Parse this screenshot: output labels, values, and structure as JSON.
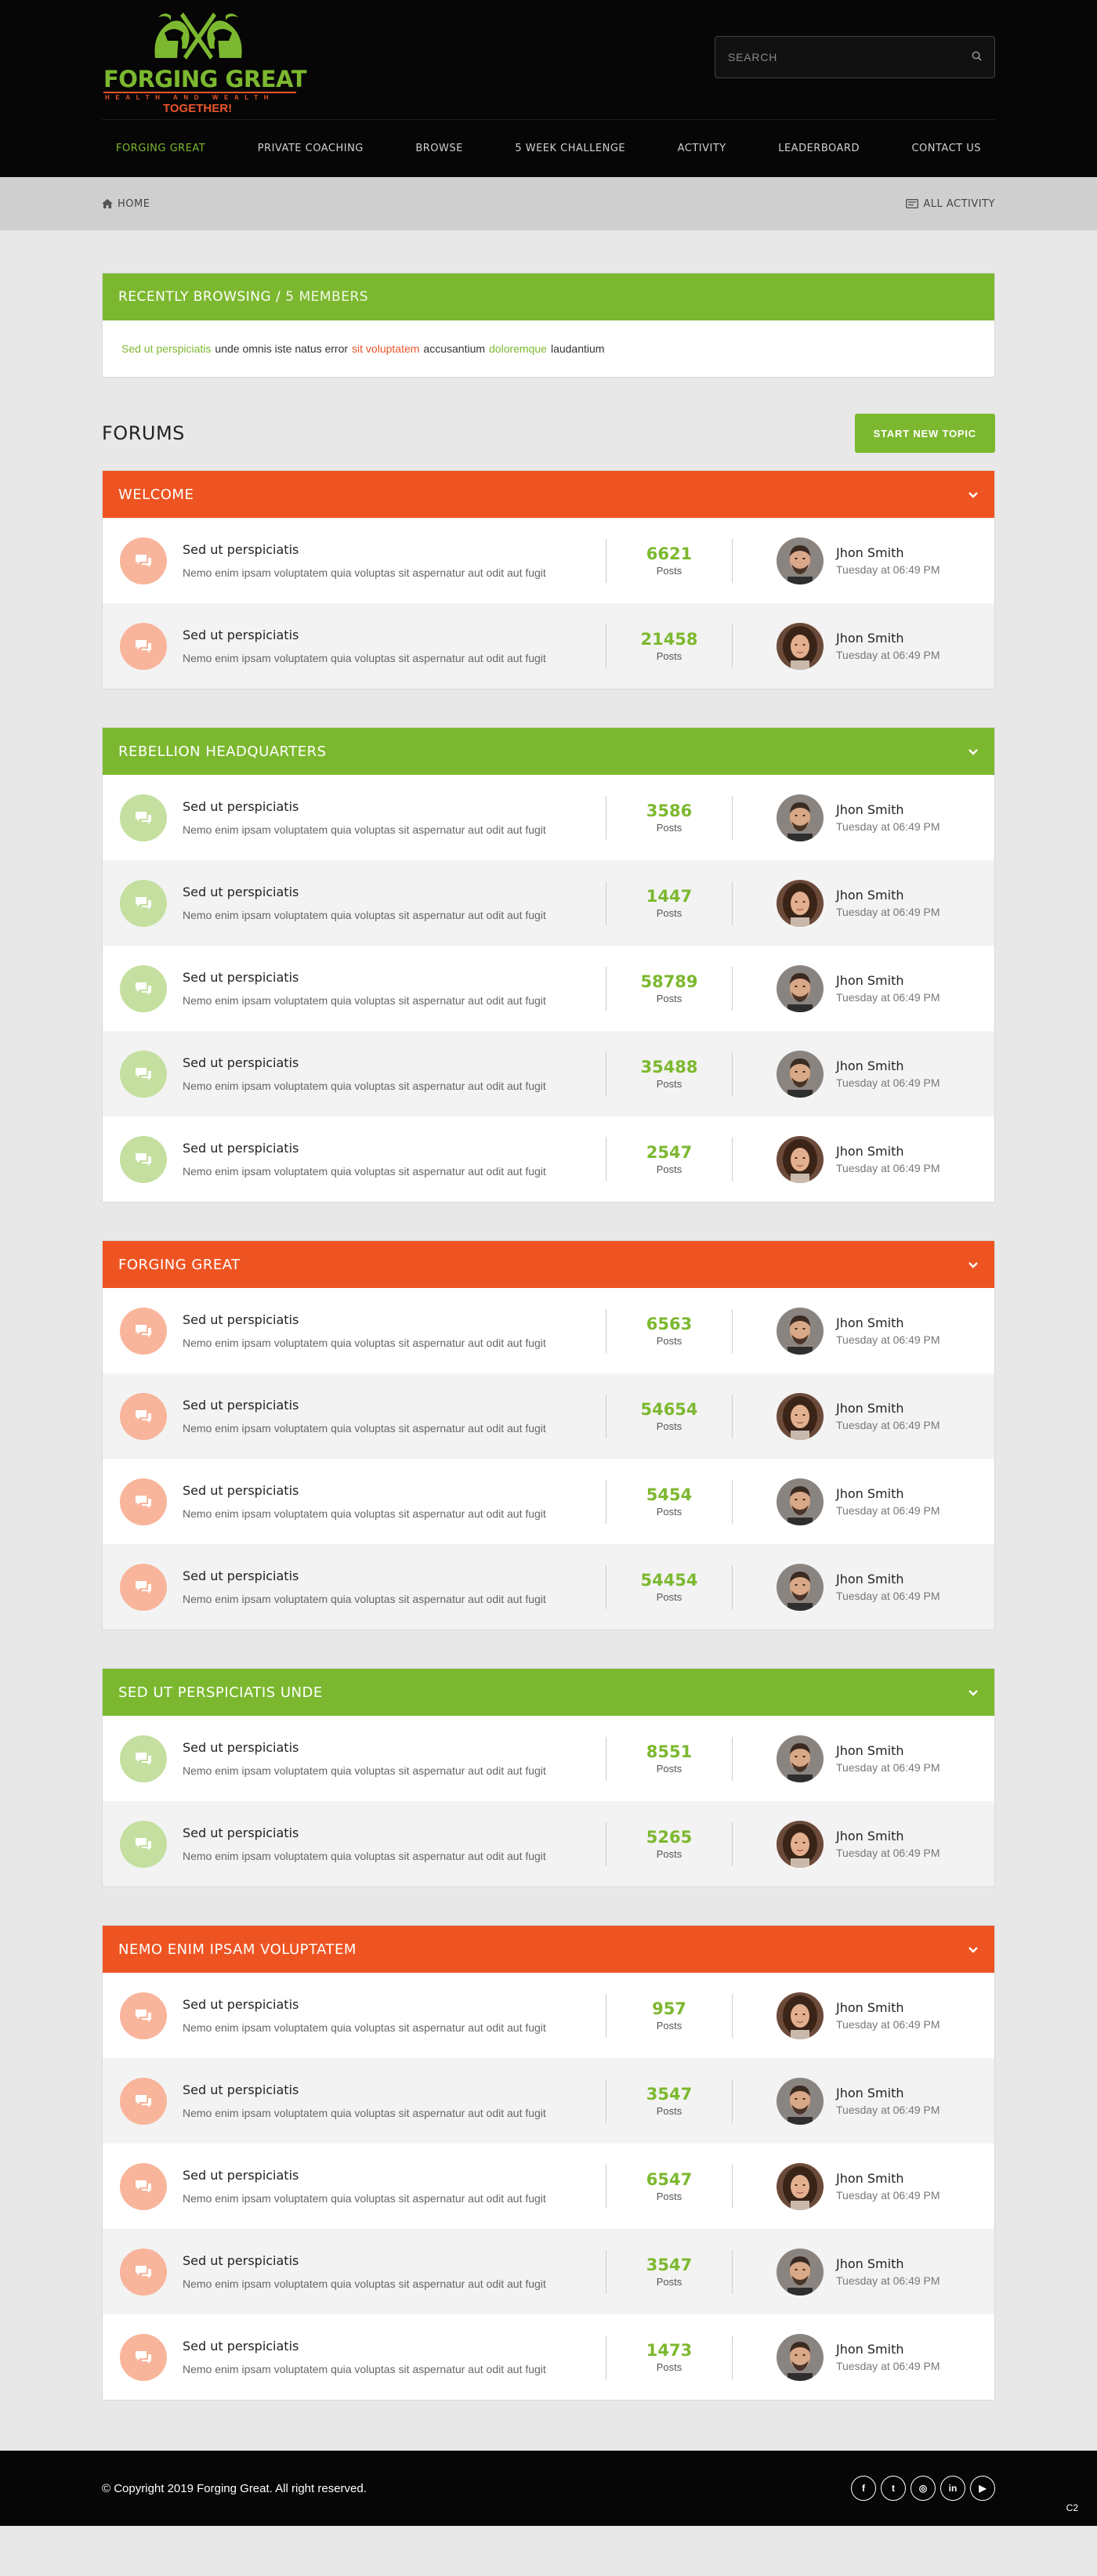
{
  "brand": {
    "name": "FORGING GREAT",
    "subtitle": "HEALTH AND WEALTH",
    "tagline": "TOGETHER!"
  },
  "search": {
    "placeholder": "SEARCH"
  },
  "nav": [
    {
      "label": "FORGING GREAT",
      "active": true
    },
    {
      "label": "PRIVATE COACHING"
    },
    {
      "label": "BROWSE"
    },
    {
      "label": "5 WEEK CHALLENGE"
    },
    {
      "label": "ACTIVITY"
    },
    {
      "label": "LEADERBOARD"
    },
    {
      "label": "CONTACT US"
    }
  ],
  "breadcrumb": {
    "home": "HOME",
    "all_activity": "ALL ACTIVITY"
  },
  "recent": {
    "title": "RECENTLY BROWSING /",
    "count": "5 MEMBERS",
    "parts": [
      {
        "text": "Sed ut perspiciatis",
        "color": "g"
      },
      {
        "text": "unde omnis iste natus error",
        "color": ""
      },
      {
        "text": "sit voluptatem",
        "color": "o"
      },
      {
        "text": "accusantium",
        "color": ""
      },
      {
        "text": "doloremque",
        "color": "g"
      },
      {
        "text": "laudantium",
        "color": ""
      }
    ]
  },
  "forums": {
    "title": "FORUMS",
    "new_topic": "START NEW TOPIC"
  },
  "topic": {
    "title": "Sed ut perspiciatis",
    "desc": "Nemo enim ipsam voluptatem quia voluptas sit aspernatur aut odit aut fugit",
    "posts_label": "Posts",
    "user": "Jhon Smith",
    "date": "Tuesday at 06:49 PM"
  },
  "categories": [
    {
      "title": "WELCOME",
      "color": "orange",
      "rows": [
        {
          "posts": "6621",
          "avatar": "m"
        },
        {
          "posts": "21458",
          "avatar": "f"
        }
      ]
    },
    {
      "title": "REBELLION HEADQUARTERS",
      "color": "green",
      "rows": [
        {
          "posts": "3586",
          "avatar": "m"
        },
        {
          "posts": "1447",
          "avatar": "f"
        },
        {
          "posts": "58789",
          "avatar": "m"
        },
        {
          "posts": "35488",
          "avatar": "m"
        },
        {
          "posts": "2547",
          "avatar": "f"
        }
      ]
    },
    {
      "title": "FORGING GREAT",
      "color": "orange",
      "rows": [
        {
          "posts": "6563",
          "avatar": "m"
        },
        {
          "posts": "54654",
          "avatar": "f"
        },
        {
          "posts": "5454",
          "avatar": "m"
        },
        {
          "posts": "54454",
          "avatar": "m"
        }
      ]
    },
    {
      "title": "SED UT PERSPICIATIS UNDE",
      "color": "green",
      "rows": [
        {
          "posts": "8551",
          "avatar": "m"
        },
        {
          "posts": "5265",
          "avatar": "f"
        }
      ]
    },
    {
      "title": "NEMO ENIM IPSAM VOLUPTATEM",
      "color": "orange",
      "rows": [
        {
          "posts": "957",
          "avatar": "f"
        },
        {
          "posts": "3547",
          "avatar": "m"
        },
        {
          "posts": "6547",
          "avatar": "f"
        },
        {
          "posts": "3547",
          "avatar": "m"
        },
        {
          "posts": "1473",
          "avatar": "m"
        }
      ]
    }
  ],
  "footer": {
    "copyright": "© Copyright 2019 Forging Great. All right reserved.",
    "social": [
      {
        "name": "facebook-icon",
        "glyph": "f"
      },
      {
        "name": "twitter-icon",
        "glyph": "t"
      },
      {
        "name": "instagram-icon",
        "glyph": "◎"
      },
      {
        "name": "linkedin-icon",
        "glyph": "in"
      },
      {
        "name": "youtube-icon",
        "glyph": "▶"
      }
    ],
    "badge": "C2"
  },
  "colors": {
    "green": "#7cb82f",
    "orange": "#ee5422",
    "dark": "#060606"
  }
}
